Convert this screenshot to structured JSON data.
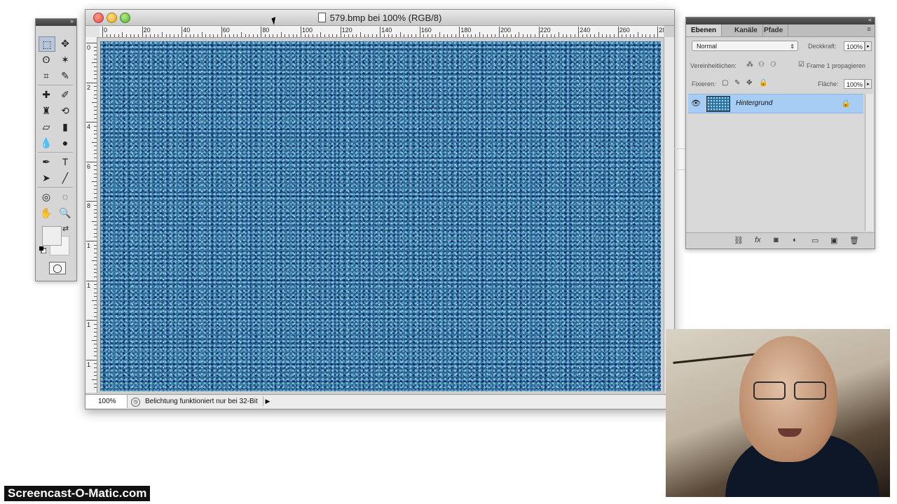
{
  "document": {
    "title": "579.bmp bei 100% (RGB/8)",
    "zoom": "100%",
    "status_text": "Belichtung funktioniert nur bei 32-Bit",
    "ruler_h_labels": [
      "0",
      "20",
      "40",
      "60",
      "80",
      "100",
      "120",
      "140",
      "160",
      "180",
      "200",
      "220",
      "240",
      "260",
      "28"
    ],
    "ruler_v_labels": [
      "0",
      "2",
      "4",
      "6",
      "8",
      "1",
      "1",
      "1",
      "1",
      "1"
    ],
    "canvas_colors": [
      "#2a6c9a",
      "#0c2a5e",
      "#aae6f5"
    ]
  },
  "tools_panel": {
    "header_icon": "double-chevron-icon",
    "tools": [
      {
        "name": "marquee-tool",
        "glyph": "⬚"
      },
      {
        "name": "move-tool",
        "glyph": "✥"
      },
      {
        "name": "lasso-tool",
        "glyph": "ʘ"
      },
      {
        "name": "magic-wand-tool",
        "glyph": "✶"
      },
      {
        "name": "crop-tool",
        "glyph": "⌗"
      },
      {
        "name": "eyedropper-tool",
        "glyph": "✎"
      },
      {
        "name": "healing-brush-tool",
        "glyph": "✚"
      },
      {
        "name": "brush-tool",
        "glyph": "✐"
      },
      {
        "name": "stamp-tool",
        "glyph": "♜"
      },
      {
        "name": "history-brush-tool",
        "glyph": "⟲"
      },
      {
        "name": "eraser-tool",
        "glyph": "▱"
      },
      {
        "name": "gradient-tool",
        "glyph": "▮"
      },
      {
        "name": "blur-tool",
        "glyph": "💧"
      },
      {
        "name": "dodge-tool",
        "glyph": "●"
      },
      {
        "name": "pen-tool",
        "glyph": "✒"
      },
      {
        "name": "type-tool",
        "glyph": "T"
      },
      {
        "name": "path-selection-tool",
        "glyph": "➤"
      },
      {
        "name": "line-tool",
        "glyph": "╱"
      },
      {
        "name": "3d-rotate-tool",
        "glyph": "◎"
      },
      {
        "name": "3d-orbit-tool",
        "glyph": "◌"
      },
      {
        "name": "hand-tool",
        "glyph": "✋"
      },
      {
        "name": "zoom-tool",
        "glyph": "🔍"
      }
    ],
    "swap_icon": "⇄",
    "quick_mask_icon": "◯",
    "foreground_color": "#eeeeee",
    "background_color": "#f3f3f3"
  },
  "layers_panel": {
    "tabs": [
      "Ebenen",
      "Kanäle",
      "Pfade"
    ],
    "active_tab": "Ebenen",
    "menu_icon": "≡",
    "blend_mode": "Normal",
    "opacity_label": "Deckkraft:",
    "opacity_value": "100%",
    "unify_label": "Vereinheitlichen:",
    "propagate_label": "Frame 1 propagieren",
    "lock_label": "Fixieren:",
    "fill_label": "Fläche:",
    "fill_value": "100%",
    "layer_name": "Hintergrund",
    "footer_icons": [
      "link-icon",
      "fx-icon",
      "mask-icon",
      "adjustment-icon",
      "folder-icon",
      "new-layer-icon",
      "trash-icon"
    ],
    "selected_color": "#a8cdf5"
  },
  "watermark": "Screencast-O-Matic.com"
}
